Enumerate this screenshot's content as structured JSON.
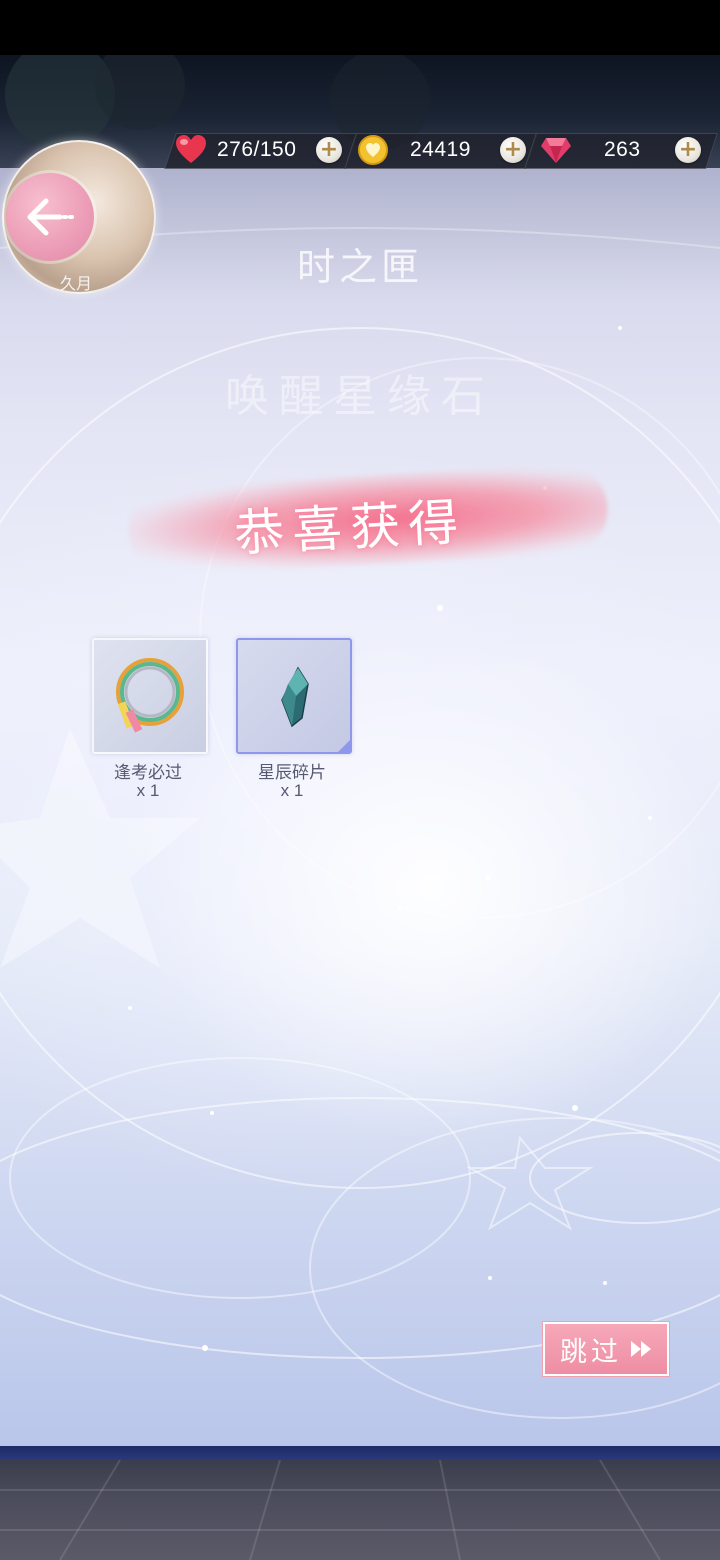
{
  "resources": {
    "stamina": "276/150",
    "coins": "24419",
    "gems": "263"
  },
  "avatar": {
    "name": "久月"
  },
  "header": {
    "title": "时之匣",
    "subtitle": "唤醒星缘石"
  },
  "reward": {
    "heading": "恭喜获得",
    "items": [
      {
        "name": "逢考必过",
        "qty": "x 1",
        "icon": "rainbow-ring-icon"
      },
      {
        "name": "星辰碎片",
        "qty": "x 1",
        "icon": "star-crystal-icon"
      }
    ]
  },
  "skip": {
    "label": "跳过"
  },
  "colors": {
    "accent": "#ee8ea4",
    "selected_border": "#8e97ea",
    "text": "#555a70"
  }
}
